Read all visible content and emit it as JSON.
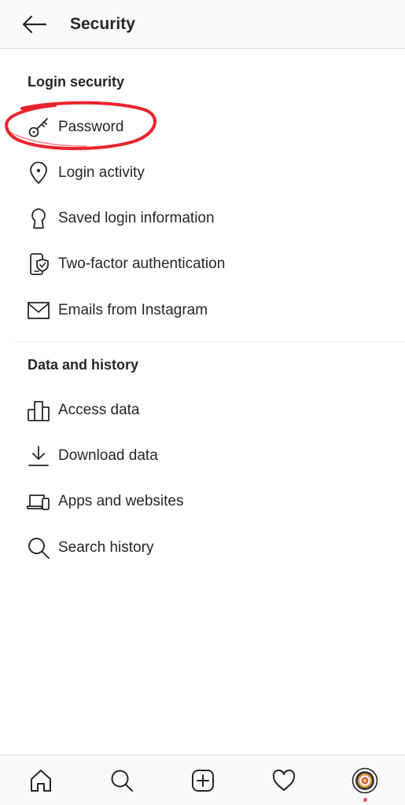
{
  "header": {
    "back_icon": "arrow-left-icon",
    "title": "Security"
  },
  "sections": [
    {
      "heading": "Login security",
      "items": [
        {
          "label": "Password",
          "icon": "key-icon"
        },
        {
          "label": "Login activity",
          "icon": "location-pin-icon"
        },
        {
          "label": "Saved login information",
          "icon": "keyhole-icon"
        },
        {
          "label": "Two-factor authentication",
          "icon": "phone-shield-icon"
        },
        {
          "label": "Emails from Instagram",
          "icon": "envelope-icon"
        }
      ]
    },
    {
      "heading": "Data and history",
      "items": [
        {
          "label": "Access data",
          "icon": "bar-chart-icon"
        },
        {
          "label": "Download data",
          "icon": "download-icon"
        },
        {
          "label": "Apps and websites",
          "icon": "laptop-phone-icon"
        },
        {
          "label": "Search history",
          "icon": "search-icon"
        }
      ]
    }
  ],
  "tabbar": {
    "tabs": [
      "home-icon",
      "search-icon",
      "new-post-icon",
      "heart-icon",
      "profile-avatar-icon"
    ],
    "notification_dot_color": "#ed4956"
  },
  "annotation_color": "#e8232b"
}
